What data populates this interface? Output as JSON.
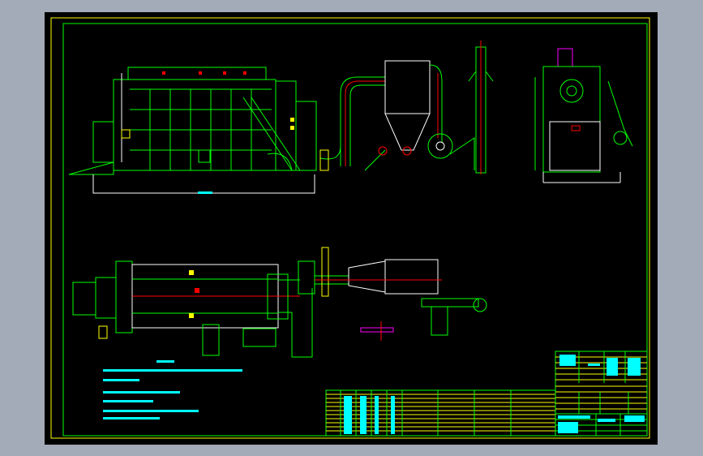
{
  "colors": {
    "background": "#a3aab8",
    "canvas": "#000000",
    "border": "#ffff00",
    "geometry": "#00ff00",
    "centerline": "#ff0000",
    "annotation": "#00ffff",
    "hidden": "#0000ff",
    "outline": "#ffffff",
    "magenta": "#ff00ff"
  },
  "notes": {
    "count": 5
  }
}
